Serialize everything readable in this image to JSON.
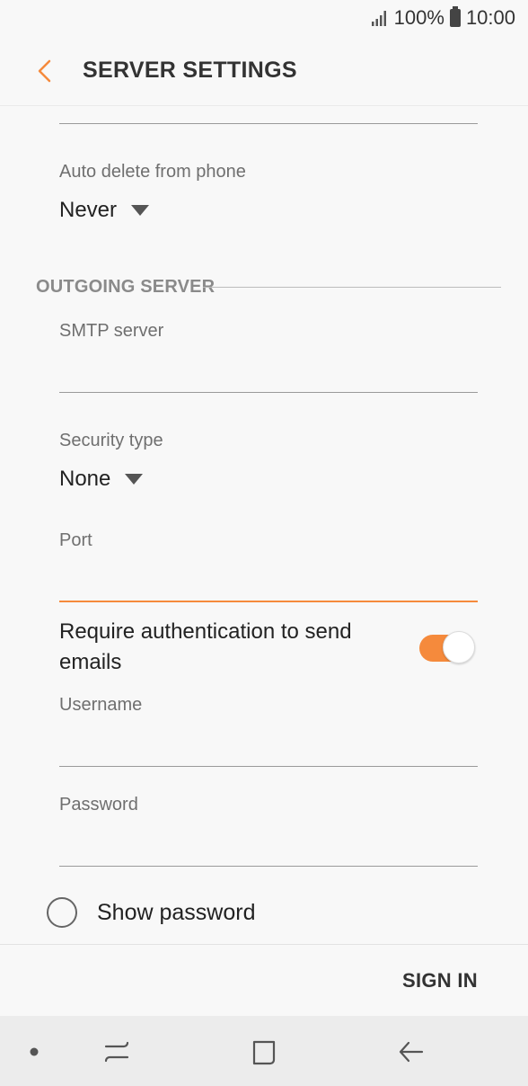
{
  "status_bar": {
    "battery": "100%",
    "time": "10:00"
  },
  "header": {
    "title": "SERVER SETTINGS"
  },
  "colors": {
    "accent": "#f58a3c"
  },
  "incoming": {
    "auto_delete_label": "Auto delete from phone",
    "auto_delete_value": "Never"
  },
  "outgoing": {
    "section_title": "OUTGOING SERVER",
    "smtp_label": "SMTP server",
    "smtp_value": "",
    "security_label": "Security type",
    "security_value": "None",
    "port_label": "Port",
    "port_value": "",
    "require_auth_label": "Require authentication to send emails",
    "require_auth_on": true,
    "username_label": "Username",
    "username_value": "",
    "password_label": "Password",
    "password_value": "",
    "show_password_label": "Show password"
  },
  "footer": {
    "sign_in": "SIGN IN"
  },
  "nav": {
    "icons": [
      "dot-icon",
      "recent-apps-icon",
      "home-icon",
      "back-icon"
    ]
  }
}
